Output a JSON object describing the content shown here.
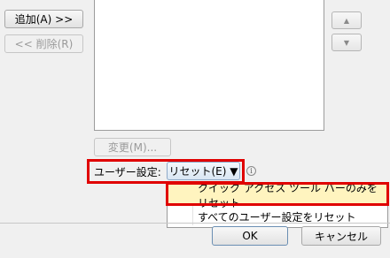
{
  "left_buttons": {
    "add": "追加(A) >>",
    "remove": "<< 削除(R)"
  },
  "modify_button": "変更(M)...",
  "customization": {
    "label": "ユーザー設定:",
    "reset_button": "リセット(E) ▼"
  },
  "reset_menu": {
    "items": [
      "クイック アクセス ツール バーのみをリセット",
      "すべてのユーザー設定をリセット"
    ]
  },
  "move_buttons": {
    "up": "▲",
    "down": "▼"
  },
  "footer": {
    "ok": "OK",
    "cancel": "キャンセル"
  },
  "icons": {
    "info": "i"
  },
  "colors": {
    "highlight": "#e00000",
    "menu_selected": "#fff4bf"
  }
}
